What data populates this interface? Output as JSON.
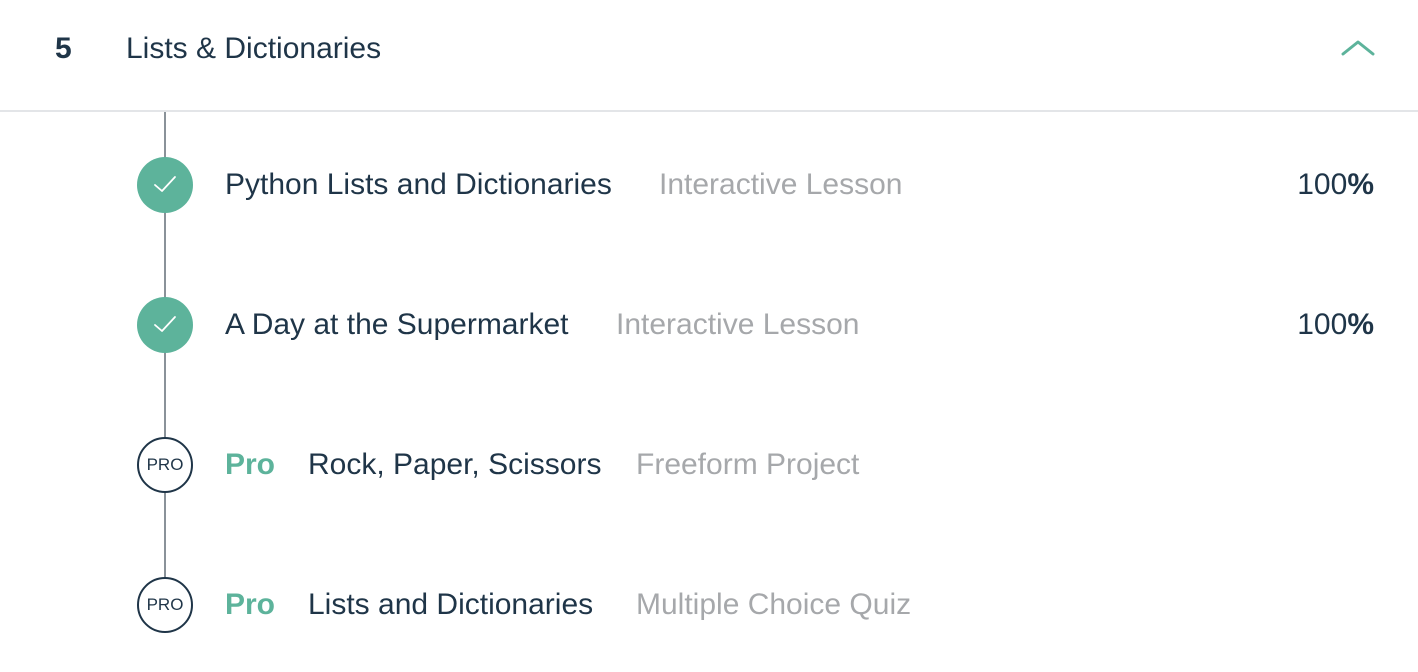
{
  "unit": {
    "number": "5",
    "title": "Lists & Dictionaries",
    "collapse_icon": "chevron-up-icon"
  },
  "colors": {
    "accent": "#5db39b",
    "text": "#1f3548",
    "muted": "#a6a8ab",
    "line": "#8a9299"
  },
  "items": [
    {
      "status": "complete",
      "status_icon": "checkmark-icon",
      "title": "Python Lists and Dictionaries",
      "type": "Interactive Lesson",
      "progress_value": "100",
      "progress_unit": "%"
    },
    {
      "status": "complete",
      "status_icon": "checkmark-icon",
      "title": "A Day at the Supermarket",
      "type": "Interactive Lesson",
      "progress_value": "100",
      "progress_unit": "%"
    },
    {
      "status": "pro",
      "badge": "PRO",
      "pro_label": "Pro",
      "title": "Rock, Paper, Scissors",
      "type": "Freeform Project"
    },
    {
      "status": "pro",
      "badge": "PRO",
      "pro_label": "Pro",
      "title": "Lists and Dictionaries",
      "type": "Multiple Choice Quiz"
    }
  ]
}
